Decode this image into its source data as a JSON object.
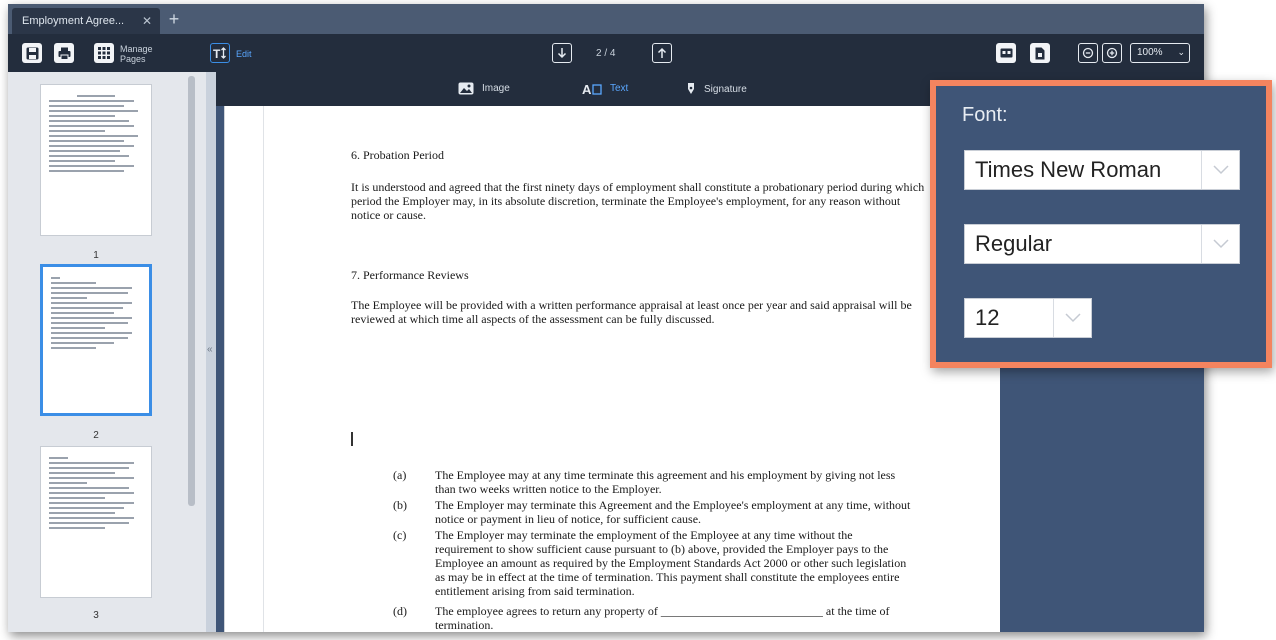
{
  "window": {
    "tab_title": "Employment Agree...",
    "tab_close": "✕",
    "tab_new": "+"
  },
  "toolbar": {
    "manage_pages_line1": "Manage",
    "manage_pages_line2": "Pages",
    "edit_label": "Edit",
    "page_indicator": "2 / 4",
    "zoom_value": "100%"
  },
  "edit_toolbar": {
    "image_label": "Image",
    "text_label": "Text",
    "signature_label": "Signature"
  },
  "sidebar": {
    "thumbnails": [
      {
        "number": "1"
      },
      {
        "number": "2"
      },
      {
        "number": "3"
      }
    ],
    "collapse_arrow": "«"
  },
  "document": {
    "section6_heading": "6. Probation Period",
    "section6_text": "It is understood and agreed that the first ninety days of employment shall constitute a probationary period during which period the Employer may, in its absolute discretion, terminate the Employee's employment, for any reason without notice or cause.",
    "section7_heading": "7. Performance Reviews",
    "section7_text": "The Employee will be provided with a written performance appraisal at least once per year and said appraisal will be reviewed at which time all aspects of the assessment can be fully discussed.",
    "list": [
      {
        "label": "(a)",
        "text": "The Employee may at any time terminate this agreement and his employment by giving not less than two weeks written notice to the Employer."
      },
      {
        "label": "(b)",
        "text": "The Employer may terminate this Agreement and the Employee's employment at any time, without notice or payment in lieu of notice, for sufficient cause."
      },
      {
        "label": "(c)",
        "text": "The Employer may terminate the employment of the Employee at any time without the requirement to show sufficient cause pursuant to (b) above, provided the Employer pays to the Employee an amount as required by the Employment Standards Act 2000 or other such legislation as may be in effect at the time of termination.  This payment shall constitute the employees entire entitlement arising from said termination."
      },
      {
        "label": "(d)",
        "text": "The employee agrees to return any property of ___________________________ at the time of termination."
      }
    ]
  },
  "font_panel": {
    "label": "Font:",
    "font_family": "Times New Roman",
    "font_style": "Regular",
    "font_size": "12",
    "border_color": "#f4845f"
  }
}
